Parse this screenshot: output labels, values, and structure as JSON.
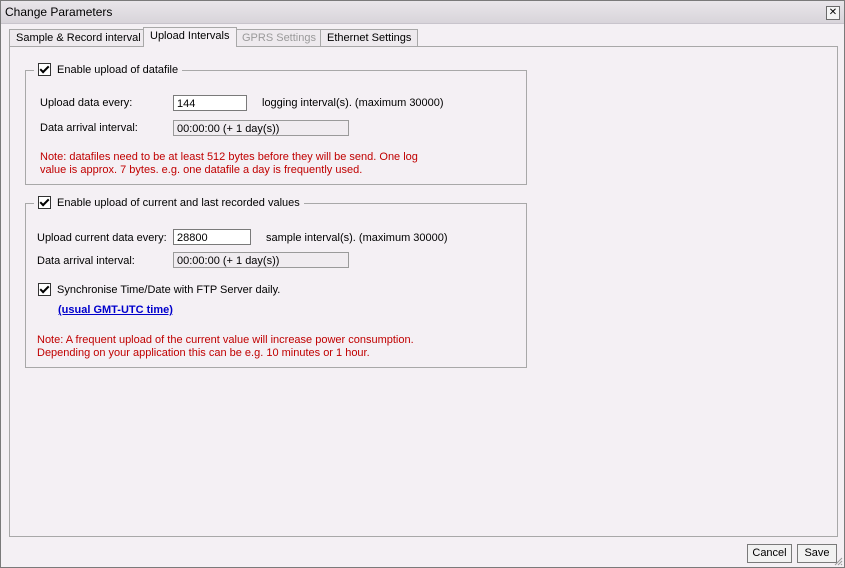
{
  "window": {
    "title": "Change Parameters",
    "close_glyph": "✕"
  },
  "tabs": [
    {
      "label": "Sample & Record interval"
    },
    {
      "label": "Upload Intervals"
    },
    {
      "label": "GPRS Settings"
    },
    {
      "label": "Ethernet Settings"
    }
  ],
  "group1": {
    "legend": "Enable upload of datafile",
    "upload_label": "Upload data every:",
    "upload_value": "144",
    "upload_suffix": "logging interval(s). (maximum 30000)",
    "arrival_label": "Data arrival  interval:",
    "arrival_value": "00:00:00 (+ 1 day(s))",
    "note_line1": "Note: datafiles need to be at least 512 bytes before they will be send. One log",
    "note_line2": "value is approx. 7 bytes. e.g. one datafile a day is frequently used."
  },
  "group2": {
    "legend": "Enable upload of current and last recorded values",
    "upload_label": "Upload current data every:",
    "upload_value": "28800",
    "upload_suffix": "sample interval(s).  (maximum 30000)",
    "arrival_label": "Data arrival  interval:",
    "arrival_value": "00:00:00 (+ 1 day(s))",
    "sync_label": "Synchronise Time/Date with FTP Server daily.",
    "link": "(usual GMT-UTC time)",
    "note_line1": "Note: A frequent upload of the current value will increase power consumption.",
    "note_line2": "Depending on your application this can be e.g. 10 minutes or 1 hour."
  },
  "buttons": {
    "cancel": "Cancel",
    "save": "Save"
  }
}
